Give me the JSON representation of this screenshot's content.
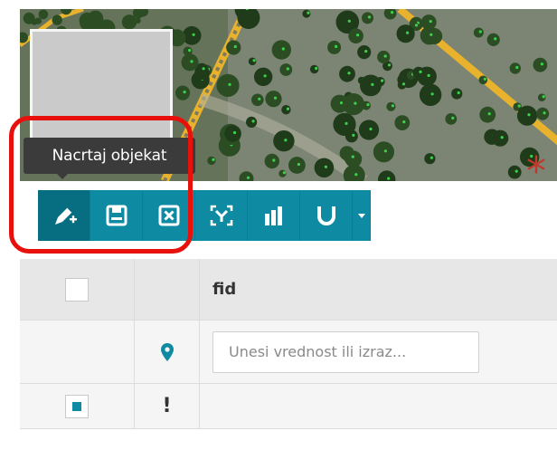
{
  "tooltip": {
    "text": "Nacrtaj objekat"
  },
  "toolbar": {
    "buttons": [
      {
        "icon": "draw-feature-icon",
        "active": true
      },
      {
        "icon": "save-icon"
      },
      {
        "icon": "cancel-icon"
      },
      {
        "icon": "select-by-expression-icon"
      },
      {
        "icon": "statistics-icon"
      },
      {
        "icon": "snapping-magnet-icon"
      },
      {
        "icon": "caret-down-icon"
      }
    ],
    "color": "#0f8aa3",
    "active_color": "#076d81"
  },
  "table": {
    "columns": [
      {
        "name": "fid"
      }
    ],
    "filter": {
      "placeholder": "Unesi vrednost ili izraz..."
    },
    "rows": [
      {
        "status": "!",
        "required_mark": "*"
      }
    ]
  },
  "highlight_color": "#e8100b"
}
